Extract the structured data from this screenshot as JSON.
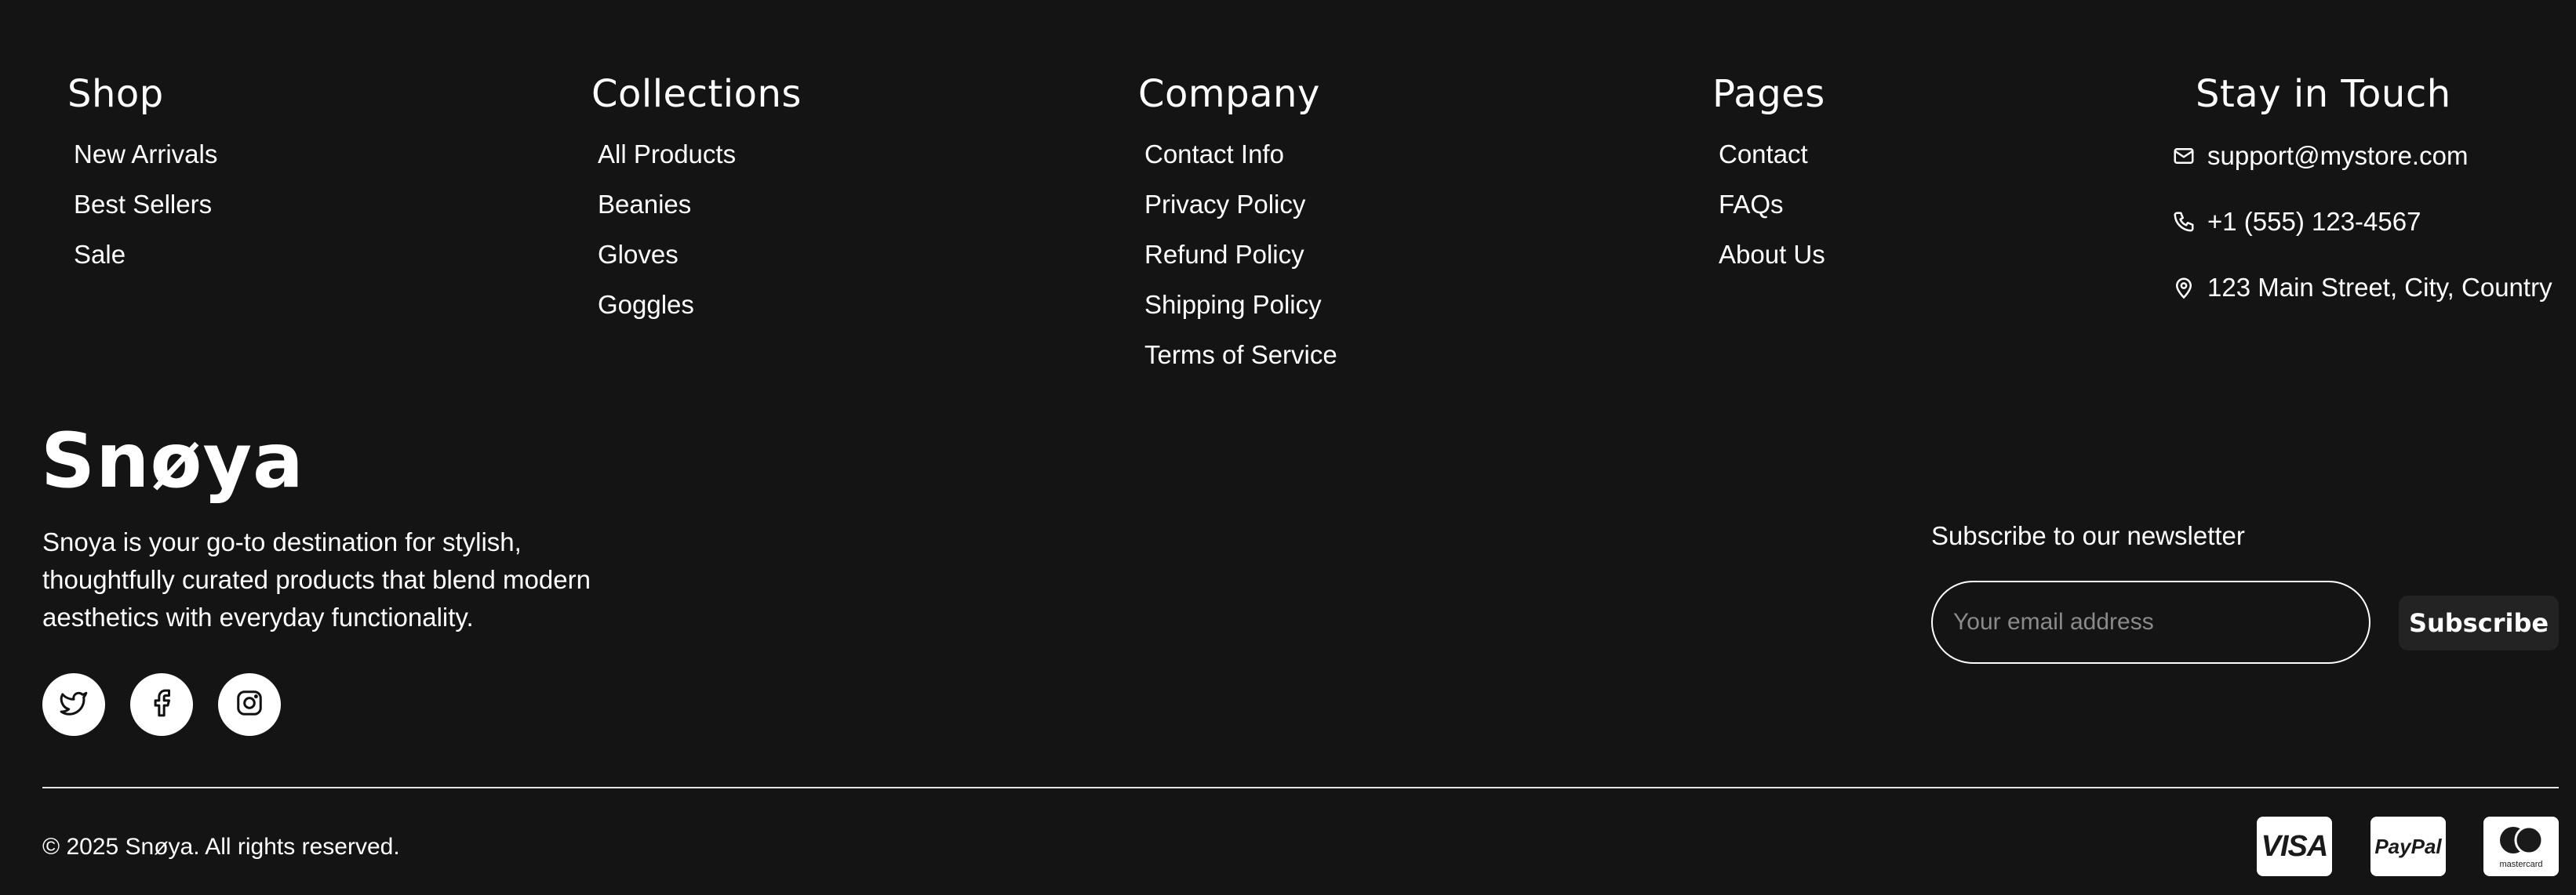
{
  "columns": {
    "shop": {
      "title": "Shop",
      "items": [
        "New Arrivals",
        "Best Sellers",
        "Sale"
      ]
    },
    "collections": {
      "title": "Collections",
      "items": [
        "All Products",
        "Beanies",
        "Gloves",
        "Goggles"
      ]
    },
    "company": {
      "title": "Company",
      "items": [
        "Contact Info",
        "Privacy Policy",
        "Refund Policy",
        "Shipping Policy",
        "Terms of Service"
      ]
    },
    "pages": {
      "title": "Pages",
      "items": [
        "Contact",
        "FAQs",
        "About Us"
      ]
    }
  },
  "contact": {
    "title": "Stay in Touch",
    "email": "support@mystore.com",
    "phone": "+1 (555) 123-4567",
    "address": "123 Main Street, City, Country"
  },
  "brand": {
    "name": "Snøya",
    "description": "Snoya is your go-to destination for stylish, thoughtfully curated products that blend modern aesthetics with everyday functionality."
  },
  "socials": [
    "twitter-icon",
    "facebook-icon",
    "instagram-icon"
  ],
  "newsletter": {
    "label": "Subscribe to our newsletter",
    "placeholder": "Your email address",
    "button": "Subscribe"
  },
  "copyright": "© 2025 Snøya. All rights reserved.",
  "payments": {
    "visa": "VISA",
    "paypal": "PayPal",
    "mastercard": "mastercard"
  },
  "colors": {
    "background": "#141414",
    "text": "#ffffff",
    "button": "#232323"
  }
}
